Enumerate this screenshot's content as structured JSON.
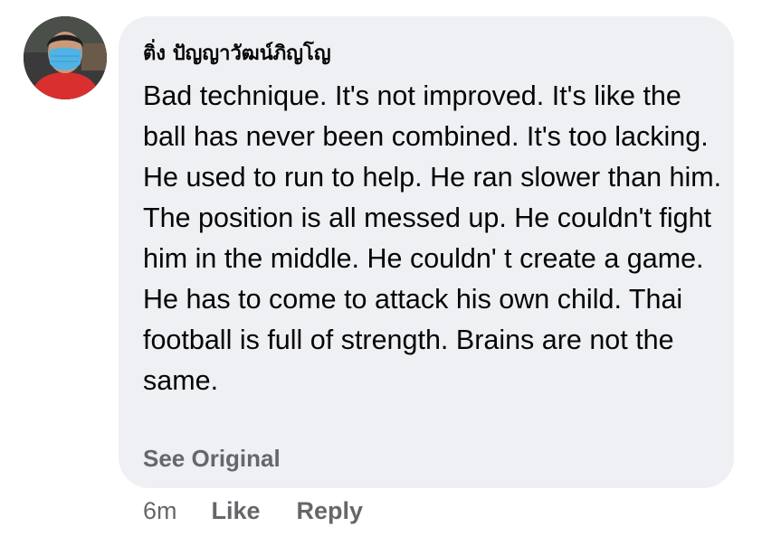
{
  "comment": {
    "author": "ติ่ง ปัญญาวัฒน์ภิญโญ",
    "text": "Bad technique. It's not improved. It's like the ball has never been combined. It's too lacking. He used to run to help. He ran slower than him. The position is all messed up. He couldn't fight him in the middle. He couldn' t create a game. He has to come to attack his own child. Thai football is full of strength. Brains are not the same.",
    "see_original_label": "See Original",
    "timestamp": "6m",
    "like_label": "Like",
    "reply_label": "Reply"
  },
  "colors": {
    "bubble_bg": "#eff0f3",
    "secondary_text": "#65676b",
    "primary_text": "#050505",
    "mask": "#4fb3e6",
    "shirt": "#d9302f"
  }
}
